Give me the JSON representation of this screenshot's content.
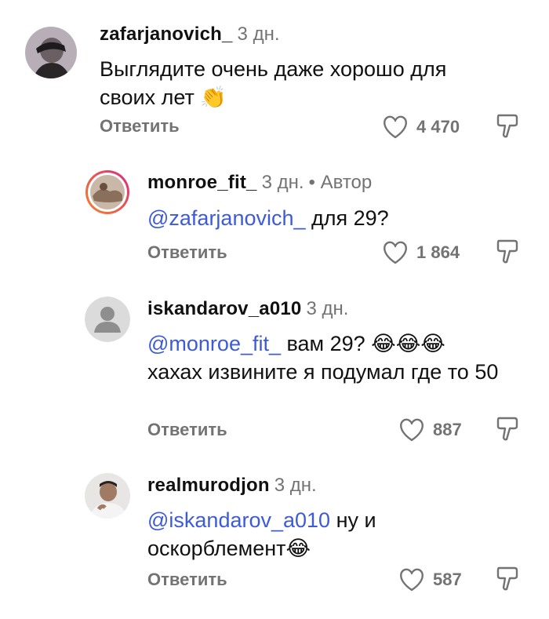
{
  "comments": [
    {
      "username": "zafarjanovich_",
      "time": "3 дн.",
      "author_tag": "",
      "mention": "",
      "text": "Выглядите очень даже хорошо для своих лет",
      "emoji": "👏",
      "reply_label": "Ответить",
      "likes": "4 470",
      "avatar": "photo-person-dark"
    },
    {
      "username": "monroe_fit_",
      "time": "3 дн.",
      "author_tag": "• Автор",
      "mention": "@zafarjanovich_",
      "text": " для 29?",
      "emoji": "",
      "reply_label": "Ответить",
      "likes": "1 864",
      "avatar": "photo-story-ring"
    },
    {
      "username": "iskandarov_a010",
      "time": "3 дн.",
      "author_tag": "",
      "mention": "@monroe_fit_",
      "text": " вам 29? ",
      "emoji": "😂😂😂",
      "text2": "хахах извините я подумал где то 50",
      "reply_label": "Ответить",
      "likes": "887",
      "avatar": "default-avatar"
    },
    {
      "username": "realmurodjon",
      "time": "3 дн.",
      "author_tag": "",
      "mention": "@iskandarov_a010",
      "text": " ну и оскорблемент",
      "emoji": "😂",
      "reply_label": "Ответить",
      "likes": "587",
      "avatar": "photo-person-light"
    }
  ],
  "colors": {
    "text": "#111111",
    "secondary": "#737373",
    "mention": "#3d5bd9",
    "story_ring_start": "#f58529",
    "story_ring_end": "#dd2a7b"
  }
}
